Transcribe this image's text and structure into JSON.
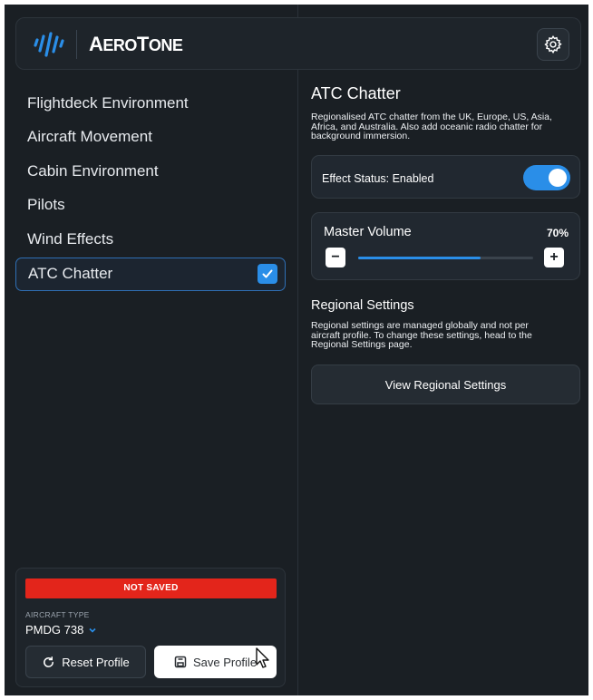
{
  "header": {
    "logo_text_big": "A",
    "logo_text_rest": "ERO",
    "logo_text_big2": "T",
    "logo_text_rest2": "ONE",
    "settings_icon": "gear-icon"
  },
  "sidebar": {
    "items": [
      {
        "label": "Flightdeck Environment"
      },
      {
        "label": "Aircraft Movement"
      },
      {
        "label": "Cabin Environment"
      },
      {
        "label": "Pilots"
      },
      {
        "label": "Wind Effects"
      },
      {
        "label": "ATC Chatter",
        "active": true,
        "checked": true
      }
    ]
  },
  "profile": {
    "status": "NOT SAVED",
    "aircraft_type_label": "AIRCRAFT TYPE",
    "aircraft_type_value": "PMDG 738",
    "reset_label": "Reset Profile",
    "save_label": "Save Profile"
  },
  "main": {
    "title": "ATC Chatter",
    "description_lines": [
      "Regionalised ATC chatter from the UK, Europe, US, Asia,",
      "Africa, and Australia. Also add oceanic radio chatter for",
      "background immersion."
    ],
    "effect_status_label": "Effect Status: Enabled",
    "effect_enabled": true,
    "master_volume_label": "Master Volume",
    "master_volume_value": "70%",
    "master_volume_fraction": 0.7,
    "regional_title": "Regional Settings",
    "regional_lines": [
      "Regional settings are managed globally and not per",
      "aircraft profile. To change these settings, head to the",
      "Regional Settings page."
    ],
    "view_regional_label": "View Regional Settings"
  },
  "colors": {
    "accent": "#2a8ee8",
    "warning": "#e3251b",
    "background": "#1a1f24"
  }
}
